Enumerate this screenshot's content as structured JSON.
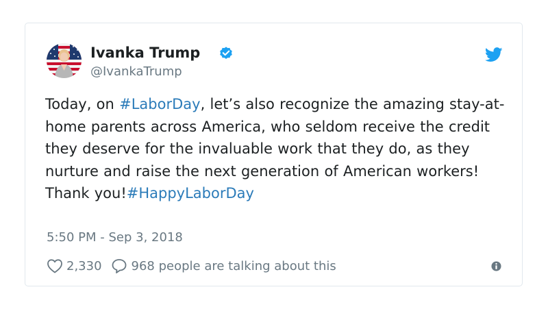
{
  "author": {
    "name": "Ivanka Trump",
    "handle": "@IvankaTrump",
    "verified": true
  },
  "tweet": {
    "segments": [
      {
        "type": "text",
        "value": "Today, on "
      },
      {
        "type": "hashtag",
        "value": "#LaborDay"
      },
      {
        "type": "text",
        "value": ", let’s also recognize the amazing stay-at-home parents across America, who seldom receive the credit they deserve for the invaluable work that they do, as they nurture and raise the next generation of American workers! Thank you!"
      },
      {
        "type": "hashtag",
        "value": "#HappyLaborDay"
      }
    ],
    "timestamp": "5:50 PM - Sep 3, 2018"
  },
  "engagement": {
    "likes": "2,330",
    "talking": "968 people are talking about this"
  },
  "icons": {
    "brand": "twitter-bird-icon",
    "verified": "verified-badge-icon",
    "like": "heart-icon",
    "reply": "speech-bubble-icon",
    "info": "info-icon"
  },
  "colors": {
    "link": "#2b7bb9",
    "muted": "#697882",
    "text": "#1c2022",
    "brand": "#1da1f2",
    "border": "#e1e8ed"
  }
}
